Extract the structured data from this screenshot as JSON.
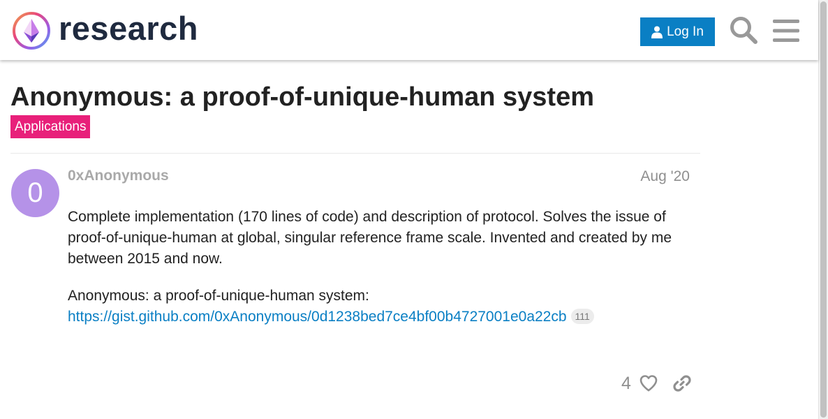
{
  "header": {
    "site_title": "research",
    "login_label": "Log In",
    "icons": {
      "logo": "ethresear-logo",
      "user": "user-icon",
      "search": "search-icon",
      "menu": "hamburger-menu-icon"
    }
  },
  "topic": {
    "title": "Anonymous: a proof-of-unique-human system",
    "category": "Applications"
  },
  "post": {
    "avatar_letter": "0",
    "username": "0xAnonymous",
    "date": "Aug '20",
    "paragraph1": "Complete implementation (170 lines of code) and description of protocol. Solves the issue of proof-of-unique-human at global, singular reference frame scale. Invented and created by me between 2015 and now.",
    "paragraph2": "Anonymous: a proof-of-unique-human system:",
    "link_text": "https://gist.github.com/0xAnonymous/0d1238bed7ce4bf00b4727001e0a22cb",
    "link_clicks": "111",
    "likes": "4",
    "icons": {
      "like": "heart-icon",
      "share": "link-icon"
    }
  },
  "colors": {
    "accent": "#0a7fc4",
    "category": "#e8207a",
    "avatar": "#b592e8",
    "title_dark": "#1f2a3f"
  }
}
